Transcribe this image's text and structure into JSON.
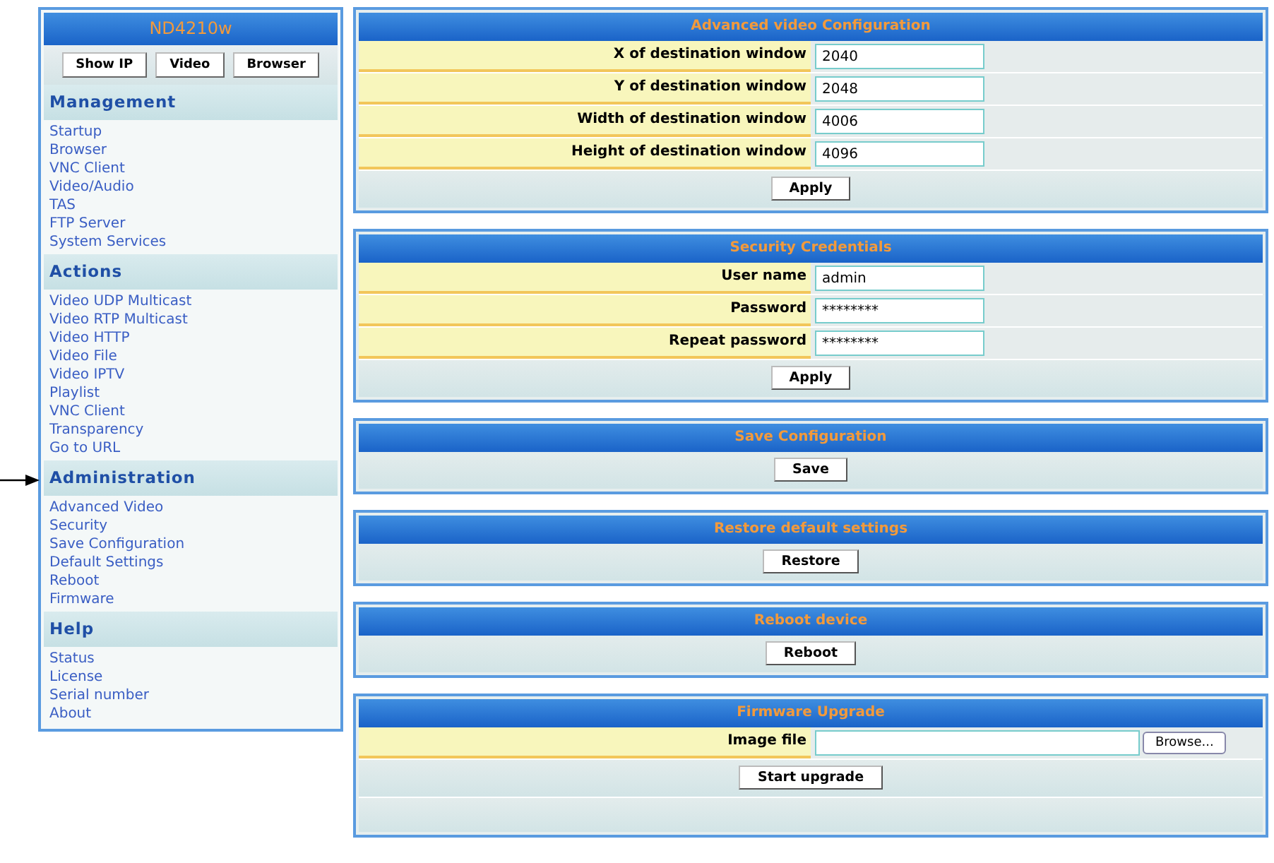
{
  "sidebar": {
    "title": "ND4210w",
    "buttons": [
      "Show IP",
      "Video",
      "Browser"
    ],
    "sections": [
      {
        "heading": "Management",
        "pointed": false,
        "items": [
          "Startup",
          "Browser",
          "VNC Client",
          "Video/Audio",
          "TAS",
          "FTP Server",
          "System Services"
        ]
      },
      {
        "heading": "Actions",
        "pointed": false,
        "items": [
          "Video UDP Multicast",
          "Video RTP Multicast",
          "Video HTTP",
          "Video File",
          "Video IPTV",
          "Playlist",
          "VNC Client",
          "Transparency",
          "Go to URL"
        ]
      },
      {
        "heading": "Administration",
        "pointed": true,
        "items": [
          "Advanced Video",
          "Security",
          "Save Configuration",
          "Default Settings",
          "Reboot",
          "Firmware"
        ]
      },
      {
        "heading": "Help",
        "pointed": false,
        "items": [
          "Status",
          "License",
          "Serial number",
          "About"
        ]
      }
    ]
  },
  "panels": [
    {
      "title": "Advanced video Configuration",
      "fields": [
        {
          "kind": "text",
          "label": "X of destination window",
          "value": "2040"
        },
        {
          "kind": "text",
          "label": "Y of destination window",
          "value": "2048"
        },
        {
          "kind": "text",
          "label": "Width of destination window",
          "value": "4006"
        },
        {
          "kind": "text",
          "label": "Height of destination window",
          "value": "4096"
        }
      ],
      "button": "Apply",
      "footer_band": false
    },
    {
      "title": "Security Credentials",
      "fields": [
        {
          "kind": "text",
          "label": "User name",
          "value": "admin"
        },
        {
          "kind": "text",
          "label": "Password",
          "value": "********"
        },
        {
          "kind": "text",
          "label": "Repeat password",
          "value": "********"
        }
      ],
      "button": "Apply",
      "footer_band": false
    },
    {
      "title": "Save Configuration",
      "button": "Save",
      "footer_band": false
    },
    {
      "title": "Restore default settings",
      "button": "Restore",
      "footer_band": false
    },
    {
      "title": "Reboot device",
      "button": "Reboot",
      "footer_band": false
    },
    {
      "title": "Firmware Upgrade",
      "fields": [
        {
          "kind": "file",
          "label": "Image file",
          "browse": "Browse..."
        }
      ],
      "button": "Start upgrade",
      "footer_band": true
    }
  ]
}
